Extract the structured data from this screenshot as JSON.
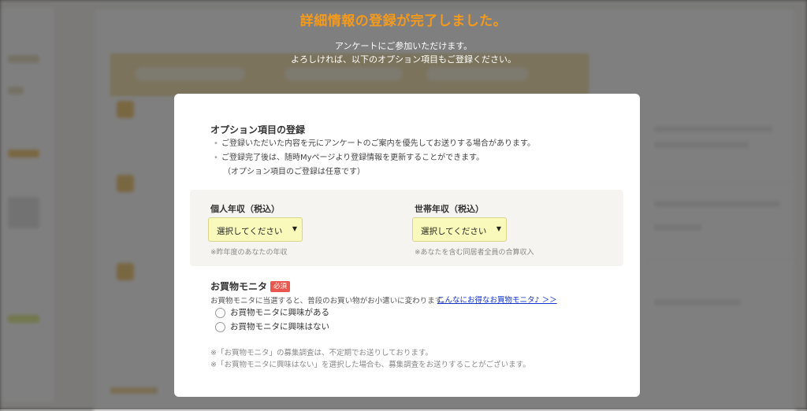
{
  "header": {
    "title": "詳細情報の登録が完了しました。",
    "subtitle_line1": "アンケートにご参加いただけます。",
    "subtitle_line2": "よろしければ、以下のオプション項目もご登録ください。"
  },
  "options": {
    "title": "オプション項目の登録",
    "bullets": [
      "ご登録いただいた内容を元にアンケートのご案内を優先してお送りする場合があります。",
      "ご登録完了後は、随時Myページより登録情報を更新することができます。"
    ],
    "bullet_note": "（オプション項目のご登録は任意です）"
  },
  "income": {
    "personal": {
      "label": "個人年収（税込）",
      "selected": "選択してください",
      "note": "※昨年度のあなたの年収"
    },
    "household": {
      "label": "世帯年収（税込）",
      "selected": "選択してください",
      "note": "※あなたを含む同居者全員の合算収入"
    }
  },
  "monitor": {
    "title": "お買物モニタ",
    "required_badge": "必須",
    "description": "お買物モニタに当選すると、普段のお買い物がお小遣いに変わります。",
    "link": "こんなにお得なお買物モニタ♪ ＞＞",
    "radio_options": [
      "お買物モニタに興味がある",
      "お買物モニタに興味はない"
    ],
    "footnotes": [
      "※「お買物モニタ」の募集調査は、不定期でお送りしております。",
      "※「お買物モニタに興味はない」を選択した場合も、募集調査をお送りすることがございます。"
    ]
  },
  "colors": {
    "title_orange": "#f49a1c",
    "select_bg": "#f8f9bb",
    "required_red": "#e9574e",
    "link_blue": "#1133cc"
  },
  "icons": {
    "select_arrow": "caret-down-icon",
    "bullet": "dot-icon"
  }
}
